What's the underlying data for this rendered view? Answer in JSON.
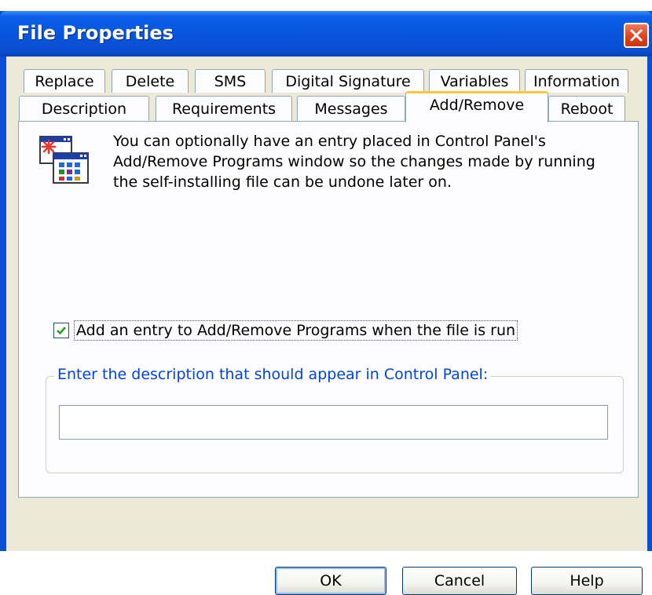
{
  "window": {
    "title": "File Properties"
  },
  "tabs_row1": [
    "Replace",
    "Delete",
    "SMS",
    "Digital Signature",
    "Variables",
    "Information"
  ],
  "tabs_row2": [
    "Description",
    "Requirements",
    "Messages",
    "Add/Remove",
    "Reboot"
  ],
  "active_tab": "Add/Remove",
  "panel": {
    "intro_text": "You can optionally have an entry placed in Control Panel's Add/Remove Programs window so the changes made by running the self-installing file can be undone later on.",
    "checkbox": {
      "label": "Add an entry to Add/Remove Programs when the file is run",
      "checked": true
    },
    "group": {
      "legend": "Enter the description that should appear in Control Panel:",
      "input_value": ""
    }
  },
  "buttons": {
    "ok": "OK",
    "cancel": "Cancel",
    "help": "Help"
  },
  "colors": {
    "titlebar": "#0856dd",
    "close": "#e0441c",
    "dialog_bg": "#ece9d8",
    "legend_text": "#0046d5",
    "active_tab_accent": "#ffc83c"
  }
}
